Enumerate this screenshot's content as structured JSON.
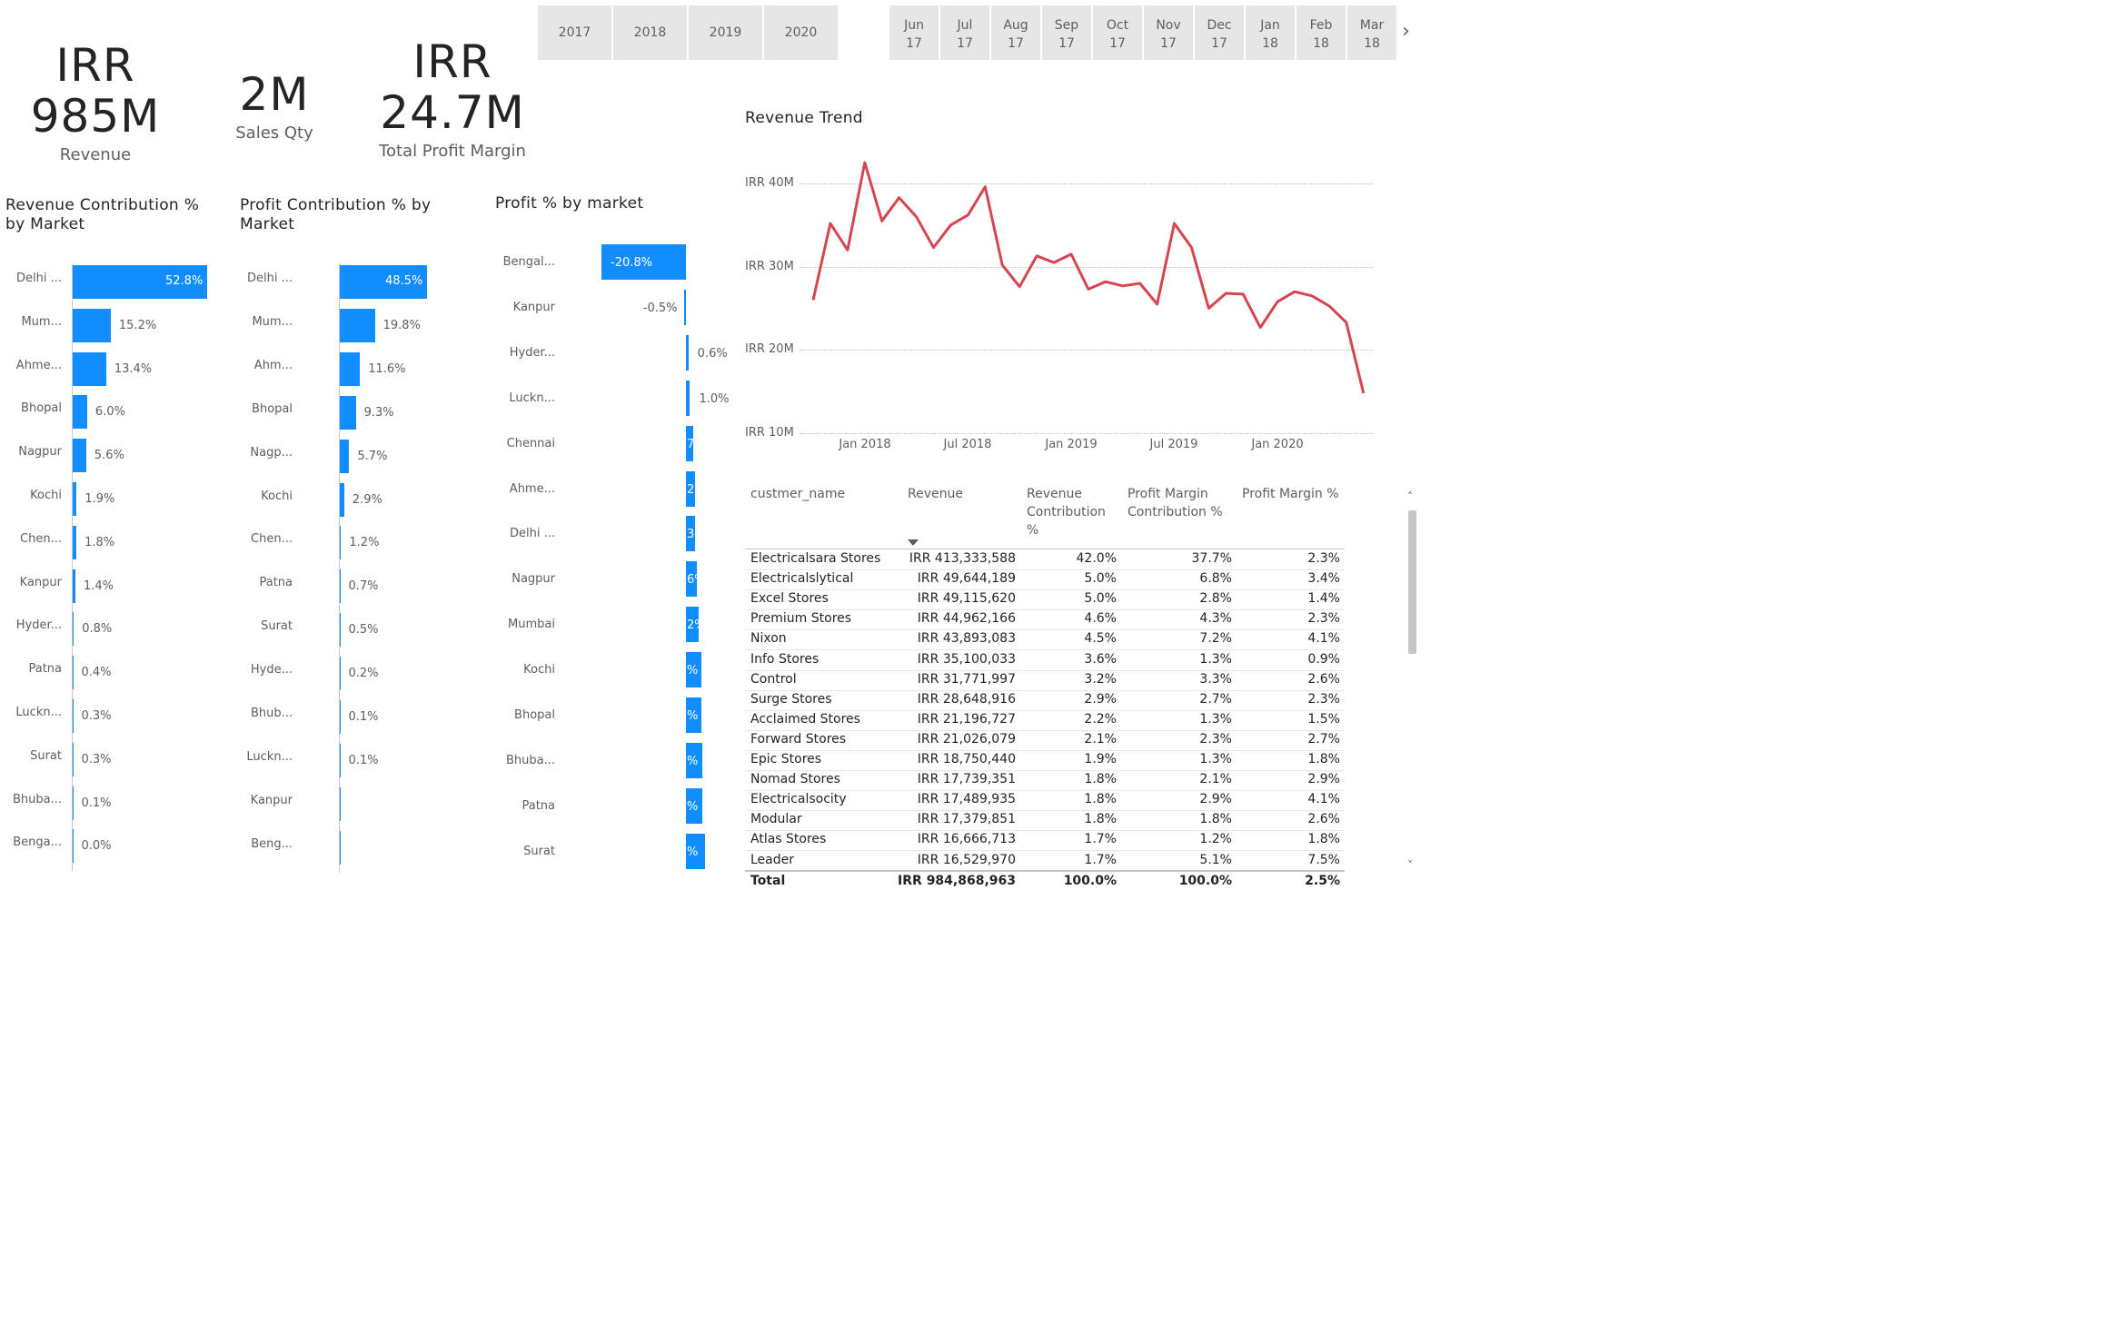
{
  "kpis": [
    {
      "line1": "IRR",
      "line2": "985M",
      "label": "Revenue"
    },
    {
      "line1": "2M",
      "line2": "",
      "label": "Sales Qty"
    },
    {
      "line1": "IRR",
      "line2": "24.7M",
      "label": "Total Profit Margin"
    }
  ],
  "year_slicer": [
    "2017",
    "2018",
    "2019",
    "2020"
  ],
  "month_slicer": [
    {
      "m": "Jun",
      "y": "17"
    },
    {
      "m": "Jul",
      "y": "17"
    },
    {
      "m": "Aug",
      "y": "17"
    },
    {
      "m": "Sep",
      "y": "17"
    },
    {
      "m": "Oct",
      "y": "17"
    },
    {
      "m": "Nov",
      "y": "17"
    },
    {
      "m": "Dec",
      "y": "17"
    },
    {
      "m": "Jan",
      "y": "18"
    },
    {
      "m": "Feb",
      "y": "18"
    },
    {
      "m": "Mar",
      "y": "18"
    }
  ],
  "month_next_icon": "chevron-right-icon",
  "accent_color": "#118dff",
  "line_color": "#d64550",
  "chart_data": [
    {
      "type": "bar",
      "orientation": "horizontal",
      "title": "Revenue Contribution % by Market",
      "categories": [
        "Delhi ...",
        "Mum...",
        "Ahme...",
        "Bhopal",
        "Nagpur",
        "Kochi",
        "Chen...",
        "Kanpur",
        "Hyder...",
        "Patna",
        "Luckn...",
        "Surat",
        "Bhuba...",
        "Benga..."
      ],
      "values": [
        52.8,
        15.2,
        13.4,
        6.0,
        5.6,
        1.9,
        1.8,
        1.4,
        0.8,
        0.4,
        0.3,
        0.3,
        0.1,
        0.0
      ],
      "labels": [
        "52.8%",
        "15.2%",
        "13.4%",
        "6.0%",
        "5.6%",
        "1.9%",
        "1.8%",
        "1.4%",
        "0.8%",
        "0.4%",
        "0.3%",
        "0.3%",
        "0.1%",
        "0.0%"
      ],
      "xlim": [
        0,
        52.8
      ]
    },
    {
      "type": "bar",
      "orientation": "horizontal",
      "title": "Profit Contribution % by Market",
      "categories": [
        "Delhi ...",
        "Mum...",
        "Ahm...",
        "Bhopal",
        "Nagp...",
        "Kochi",
        "Chen...",
        "Patna",
        "Surat",
        "Hyde...",
        "Bhub...",
        "Luckn...",
        "Kanpur",
        "Beng..."
      ],
      "values": [
        48.5,
        19.8,
        11.6,
        9.3,
        5.7,
        2.9,
        1.2,
        0.7,
        0.5,
        0.2,
        0.1,
        0.1,
        0.0,
        0.0
      ],
      "labels": [
        "48.5%",
        "19.8%",
        "11.6%",
        "9.3%",
        "5.7%",
        "2.9%",
        "1.2%",
        "0.7%",
        "0.5%",
        "0.2%",
        "0.1%",
        "0.1%",
        "",
        ""
      ],
      "xlim": [
        0,
        48.5
      ]
    },
    {
      "type": "bar",
      "orientation": "horizontal",
      "title": "Profit % by market",
      "categories": [
        "Bengal...",
        "Kanpur",
        "Hyder...",
        "Luckn...",
        "Chennai",
        "Ahme...",
        "Delhi ...",
        "Nagpur",
        "Mumbai",
        "Kochi",
        "Bhopal",
        "Bhuba...",
        "Patna",
        "Surat"
      ],
      "values": [
        -20.8,
        -0.5,
        0.6,
        1.0,
        1.7,
        2.2,
        2.3,
        2.6,
        3.2,
        3.8,
        3.8,
        4.1,
        4.1,
        4.7
      ],
      "labels": [
        "-20.8%",
        "-0.5%",
        "0.6%",
        "1.0%",
        "7",
        "2%",
        "3%",
        "6%",
        "2%",
        "%",
        "%",
        "%",
        "%",
        "%"
      ],
      "xlim": [
        -20.8,
        5
      ]
    },
    {
      "type": "line",
      "title": "Revenue Trend",
      "x": [
        "2017-10",
        "2017-11",
        "2017-12",
        "2018-01",
        "2018-02",
        "2018-03",
        "2018-04",
        "2018-05",
        "2018-06",
        "2018-07",
        "2018-08",
        "2018-09",
        "2018-10",
        "2018-11",
        "2018-12",
        "2019-01",
        "2019-02",
        "2019-03",
        "2019-04",
        "2019-05",
        "2019-06",
        "2019-07",
        "2019-08",
        "2019-09",
        "2019-10",
        "2019-11",
        "2019-12",
        "2020-01",
        "2020-02",
        "2020-03",
        "2020-04",
        "2020-05",
        "2020-06"
      ],
      "series": [
        {
          "values": [
            26.0,
            35.2,
            32.0,
            42.5,
            35.5,
            38.3,
            36.0,
            32.3,
            35.0,
            36.2,
            39.6,
            30.2,
            27.6,
            31.3,
            30.5,
            31.5,
            27.3,
            28.2,
            27.7,
            28.0,
            25.5,
            35.2,
            32.3,
            25.0,
            26.8,
            26.7,
            22.7,
            25.8,
            27.0,
            26.5,
            25.3,
            23.3,
            14.8
          ]
        }
      ],
      "y_ticks": [
        "IRR 10M",
        "IRR 20M",
        "IRR 30M",
        "IRR 40M"
      ],
      "x_ticks": [
        "Jan 2018",
        "Jul 2018",
        "Jan 2019",
        "Jul 2019",
        "Jan 2020"
      ],
      "ylim": [
        10,
        40
      ],
      "grid": true
    }
  ],
  "table": {
    "headers": [
      "custmer_name",
      "Revenue",
      "Revenue Contribution %",
      "Profit Margin Contribution %",
      "Profit Margin %"
    ],
    "sort_icon": "sort-descending-icon",
    "rows": [
      [
        "Electricalsara Stores",
        "IRR 413,333,588",
        "42.0%",
        "37.7%",
        "2.3%"
      ],
      [
        "Electricalslytical",
        "IRR 49,644,189",
        "5.0%",
        "6.8%",
        "3.4%"
      ],
      [
        "Excel Stores",
        "IRR 49,115,620",
        "5.0%",
        "2.8%",
        "1.4%"
      ],
      [
        "Premium Stores",
        "IRR 44,962,166",
        "4.6%",
        "4.3%",
        "2.3%"
      ],
      [
        "Nixon",
        "IRR 43,893,083",
        "4.5%",
        "7.2%",
        "4.1%"
      ],
      [
        "Info Stores",
        "IRR 35,100,033",
        "3.6%",
        "1.3%",
        "0.9%"
      ],
      [
        "Control",
        "IRR 31,771,997",
        "3.2%",
        "3.3%",
        "2.6%"
      ],
      [
        "Surge Stores",
        "IRR 28,648,916",
        "2.9%",
        "2.7%",
        "2.3%"
      ],
      [
        "Acclaimed Stores",
        "IRR 21,196,727",
        "2.2%",
        "1.3%",
        "1.5%"
      ],
      [
        "Forward Stores",
        "IRR 21,026,079",
        "2.1%",
        "2.3%",
        "2.7%"
      ],
      [
        "Epic Stores",
        "IRR 18,750,440",
        "1.9%",
        "1.3%",
        "1.8%"
      ],
      [
        "Nomad Stores",
        "IRR 17,739,351",
        "1.8%",
        "2.1%",
        "2.9%"
      ],
      [
        "Electricalsocity",
        "IRR 17,489,935",
        "1.8%",
        "2.9%",
        "4.1%"
      ],
      [
        "Modular",
        "IRR 17,379,851",
        "1.8%",
        "1.8%",
        "2.6%"
      ],
      [
        "Atlas Stores",
        "IRR 16,666,713",
        "1.7%",
        "1.2%",
        "1.8%"
      ],
      [
        "Leader",
        "IRR 16,529,970",
        "1.7%",
        "5.1%",
        "7.5%"
      ]
    ],
    "total": [
      "Total",
      "IRR 984,868,963",
      "100.0%",
      "100.0%",
      "2.5%"
    ]
  }
}
